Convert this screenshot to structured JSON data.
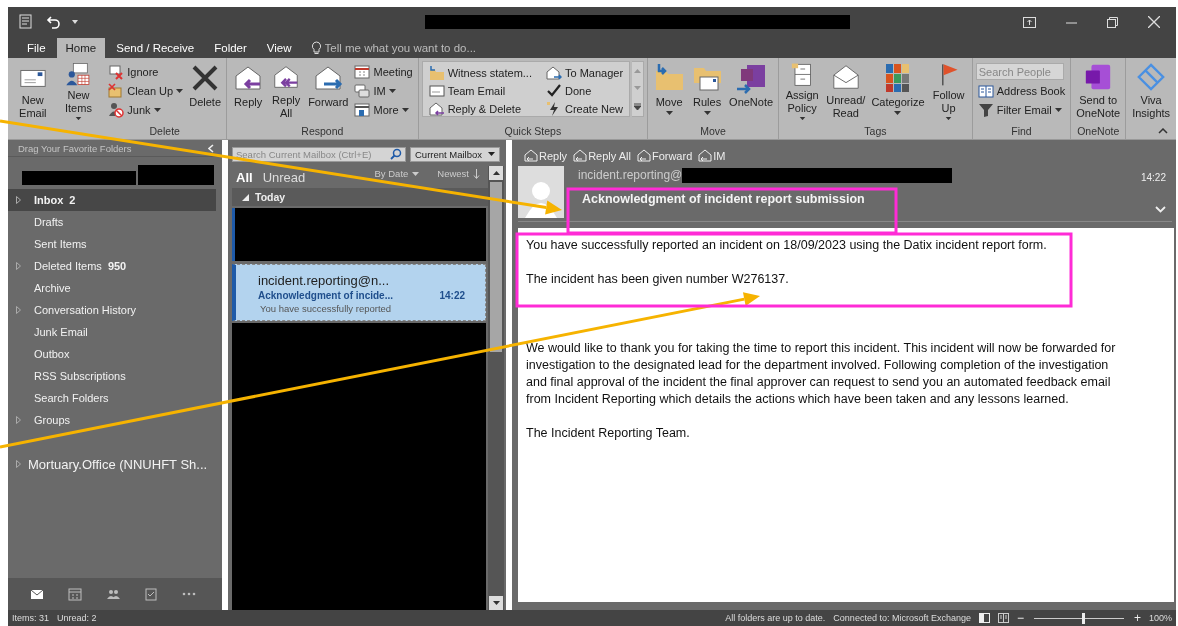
{
  "ribbon": {
    "tabs": [
      {
        "label": "File",
        "selected": false
      },
      {
        "label": "Home",
        "selected": true
      },
      {
        "label": "Send / Receive",
        "selected": false
      },
      {
        "label": "Folder",
        "selected": false
      },
      {
        "label": "View",
        "selected": false
      }
    ],
    "tell_me": {
      "placeholder": "Tell me what you want to do..."
    },
    "groups": [
      {
        "items": [
          {
            "kind": "large",
            "label": "New Email"
          },
          {
            "kind": "large",
            "label": "New Items",
            "dropdown": true
          }
        ]
      },
      {
        "label": "Delete",
        "items": [
          {
            "kind": "small",
            "label": "Ignore"
          },
          {
            "kind": "small",
            "label": "Clean Up",
            "dropdown": true
          },
          {
            "kind": "small",
            "label": "Junk",
            "dropdown": true
          },
          {
            "kind": "large",
            "label": "Delete"
          }
        ]
      },
      {
        "label": "Respond",
        "items": [
          {
            "kind": "large",
            "label": "Reply"
          },
          {
            "kind": "large",
            "label": "Reply All"
          },
          {
            "kind": "large",
            "label": "Forward"
          },
          {
            "kind": "small",
            "label": "Meeting"
          },
          {
            "kind": "small",
            "label": "IM",
            "dropdown": true
          },
          {
            "kind": "small",
            "label": "More",
            "dropdown": true
          }
        ]
      },
      {
        "label": "Quick Steps",
        "items": [
          {
            "kind": "quickstep",
            "label": "Witness statem..."
          },
          {
            "kind": "quickstep",
            "label": "To Manager"
          },
          {
            "kind": "quickstep",
            "label": "Team Email"
          },
          {
            "kind": "quickstep",
            "label": "Done"
          },
          {
            "kind": "quickstep",
            "label": "Reply & Delete"
          },
          {
            "kind": "quickstep",
            "label": "Create New"
          }
        ]
      },
      {
        "label": "Move",
        "items": [
          {
            "kind": "large",
            "label": "Move",
            "dropdown": true
          },
          {
            "kind": "large",
            "label": "Rules",
            "dropdown": true
          },
          {
            "kind": "large",
            "label": "OneNote"
          }
        ]
      },
      {
        "label": "Tags",
        "items": [
          {
            "kind": "large",
            "label": "Assign Policy",
            "dropdown": true
          },
          {
            "kind": "large",
            "label": "Unread/ Read"
          },
          {
            "kind": "large",
            "label": "Categorize",
            "dropdown": true
          },
          {
            "kind": "large",
            "label": "Follow Up",
            "dropdown": true
          }
        ]
      },
      {
        "label": "Find",
        "items": [
          {
            "kind": "search",
            "placeholder": "Search People"
          },
          {
            "kind": "small",
            "label": "Address Book"
          },
          {
            "kind": "small",
            "label": "Filter Email",
            "dropdown": true
          }
        ]
      },
      {
        "label": "OneNote",
        "items": [
          {
            "kind": "large",
            "label": "Send to OneNote"
          }
        ]
      },
      {
        "items": [
          {
            "kind": "large",
            "label": "Viva Insights"
          }
        ]
      }
    ]
  },
  "folder_pane": {
    "favorites_hint": "Drag Your Favorite Folders",
    "folders": [
      {
        "name": "Inbox",
        "count": "2",
        "expanded": false,
        "selected": true
      },
      {
        "name": "Drafts",
        "selected": false
      },
      {
        "name": "Sent Items",
        "selected": false
      },
      {
        "name": "Deleted Items",
        "count": "950",
        "expanded": false,
        "selected": false
      },
      {
        "name": "Archive",
        "selected": false
      },
      {
        "name": "Conversation History",
        "expanded": false,
        "selected": false
      },
      {
        "name": "Junk Email",
        "selected": false
      },
      {
        "name": "Outbox",
        "selected": false
      },
      {
        "name": "RSS Subscriptions",
        "selected": false
      },
      {
        "name": "Search Folders",
        "selected": false
      },
      {
        "name": "Groups",
        "expanded": false,
        "selected": false
      }
    ],
    "shared_mailbox": {
      "name": "Mortuary.Office (NNUHFT Sh...",
      "expanded": false
    }
  },
  "navigation": [
    {
      "kind": "mail",
      "selected": true
    },
    {
      "kind": "calendar",
      "selected": false
    },
    {
      "kind": "people",
      "selected": false
    },
    {
      "kind": "tasks",
      "selected": false
    },
    {
      "kind": "more",
      "selected": false
    }
  ],
  "message_list": {
    "search": {
      "placeholder": "Search Current Mailbox (Ctrl+E)"
    },
    "scope": "Current Mailbox",
    "filters": [
      {
        "label": "All",
        "selected": true
      },
      {
        "label": "Unread",
        "selected": false
      }
    ],
    "sort": "By Date",
    "order": "Newest",
    "group": "Today",
    "messages": [
      {
        "kind": "redacted"
      },
      {
        "kind": "message",
        "sender": "incident.reporting@n...",
        "subject": "Acknowledgment of incide...",
        "time": "14:22",
        "preview": "You have successfully reported",
        "selected": true
      },
      {
        "kind": "redacted"
      }
    ]
  },
  "reading_pane": {
    "actions": [
      "Reply",
      "Reply All",
      "Forward",
      "IM"
    ],
    "sender": "incident.reporting@",
    "time": "14:22",
    "subject": "Acknowledgment of incident report submission",
    "body": [
      "You have successfully reported an incident on 18/09/2023 using the Datix incident report form.",
      "The incident has been given number W276137.",
      "We would like to thank you for taking the time to report this incident. This incident will now be forwarded for investigation to the designated lead for the department involved.  Following completion of the investigation and final approval of the incident the final approver can request to send you an automated feedback email from Incident Reporting which details the actions which have been taken and any lessons learned.",
      "The Incident Reporting Team."
    ]
  },
  "status_bar": {
    "items": "Items: 31",
    "unread": "Unread: 2",
    "sync": "All folders are up to date.",
    "connection": "Connected to: Microsoft Exchange",
    "zoom_out": "−",
    "zoom_in": "+",
    "zoom": {
      "level": 0.55
    },
    "zoom_reading": "100%"
  },
  "annotations": [
    {
      "kind": "arrow"
    },
    {
      "kind": "arrow"
    },
    {
      "kind": "frame"
    },
    {
      "kind": "frame"
    }
  ]
}
